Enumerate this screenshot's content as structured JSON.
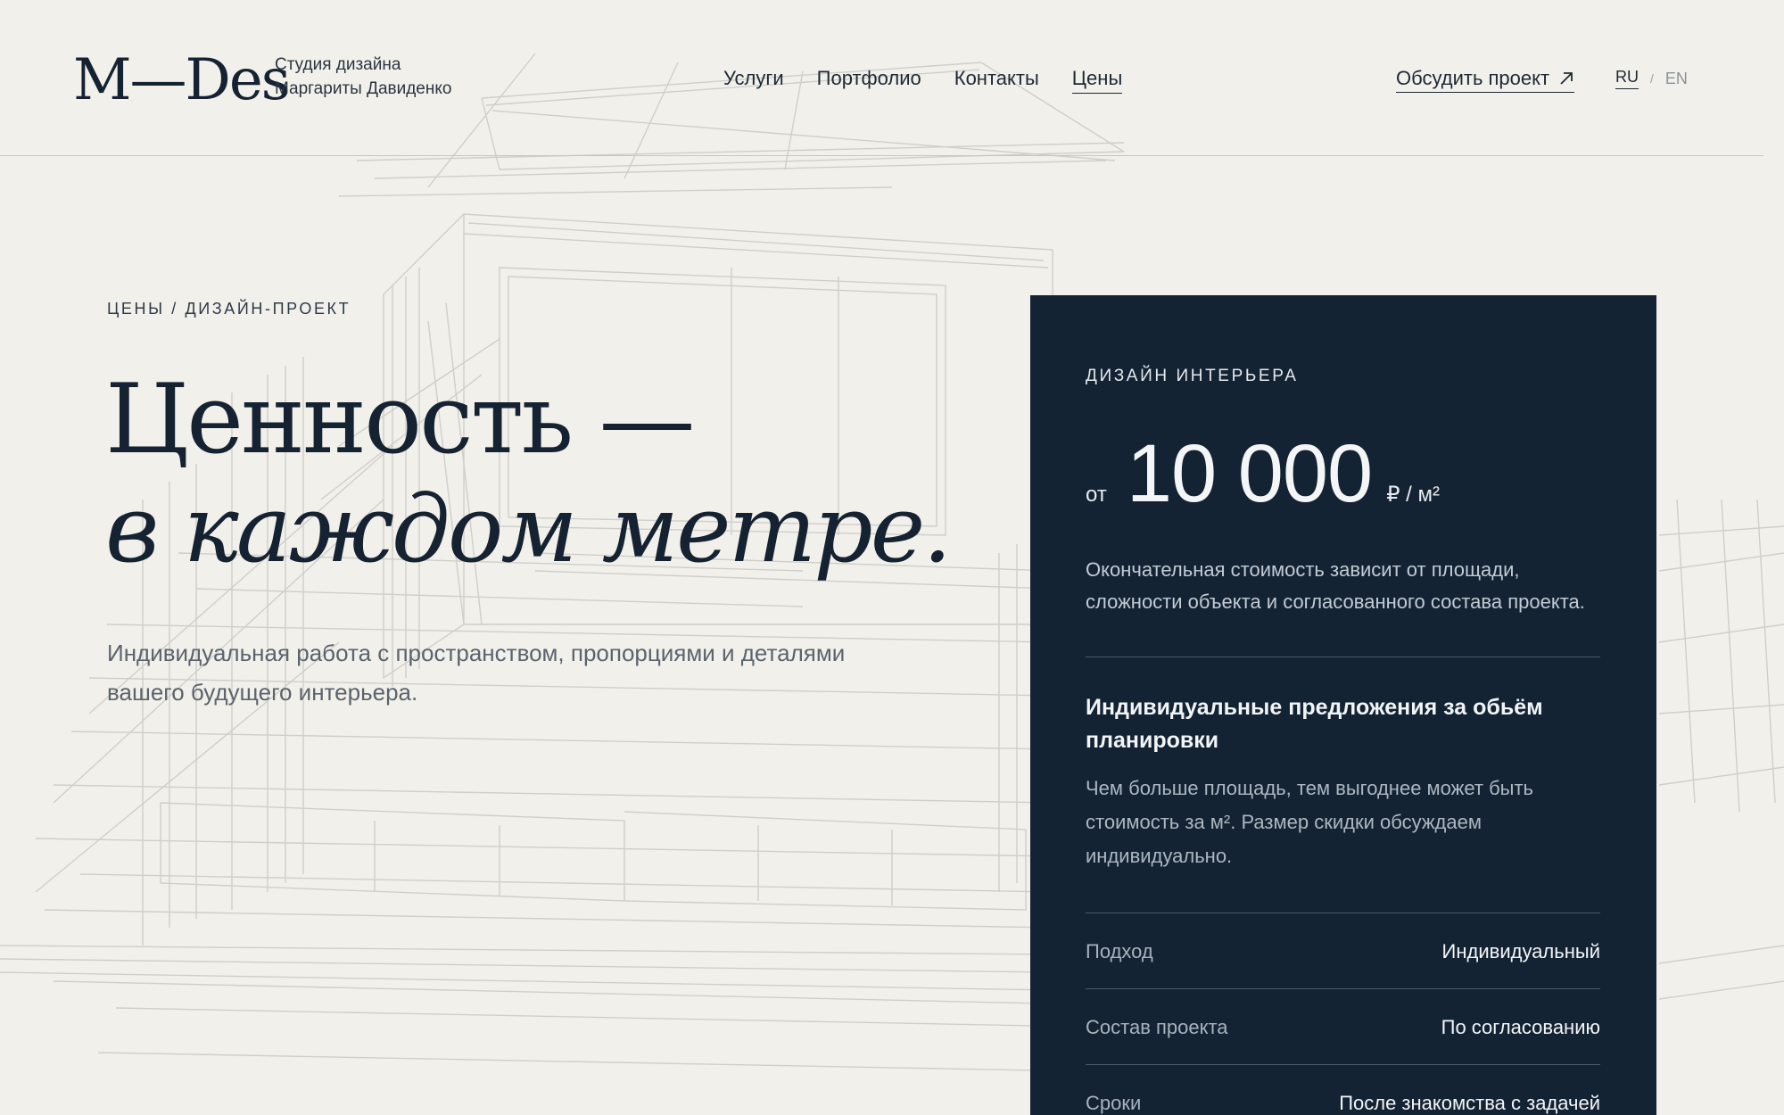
{
  "header": {
    "logo": "M—Des",
    "tagline": [
      "Студия дизайна",
      "Маргариты Давиденко"
    ],
    "nav": [
      {
        "label": "Услуги",
        "active": false
      },
      {
        "label": "Портфолио",
        "active": false
      },
      {
        "label": "Контакты",
        "active": false
      },
      {
        "label": "Цены",
        "active": true
      }
    ],
    "cta_label": "Обсудить проект",
    "lang": {
      "ru": "RU",
      "separator": "/",
      "en": "EN",
      "active": "RU"
    }
  },
  "hero": {
    "breadcrumb": "ЦЕНЫ / ДИЗАЙН-ПРОЕКТ",
    "title_line1": "Ценность —",
    "title_line2": "в каждом метре.",
    "description": "Индивидуальная работа с пространством, пропорциями и деталями вашего будущего интерьера."
  },
  "card": {
    "eyebrow": "ДИЗАЙН ИНТЕРЬЕРА",
    "price_prefix": "от",
    "price_amount": "10 000",
    "price_unit": "₽ / м²",
    "note": "Окончательная стоимость зависит от площади, сложности объекта и согласованного состава проекта.",
    "offer_title": "Индивидуальные предложения за обьём планировки",
    "offer_text": "Чем больше площадь, тем выгоднее может быть стоимость за м². Размер скидки обсуждаем индивидуально.",
    "rows": [
      {
        "key": "Подход",
        "value": "Индивидуальный"
      },
      {
        "key": "Состав проекта",
        "value": "По согласованию"
      },
      {
        "key": "Сроки",
        "value": "После знакомства с задачей"
      }
    ]
  },
  "colors": {
    "background": "#f2f0eb",
    "ink": "#152232",
    "card": "#132334"
  },
  "icons": {
    "cta": "arrow-up-right-icon"
  }
}
